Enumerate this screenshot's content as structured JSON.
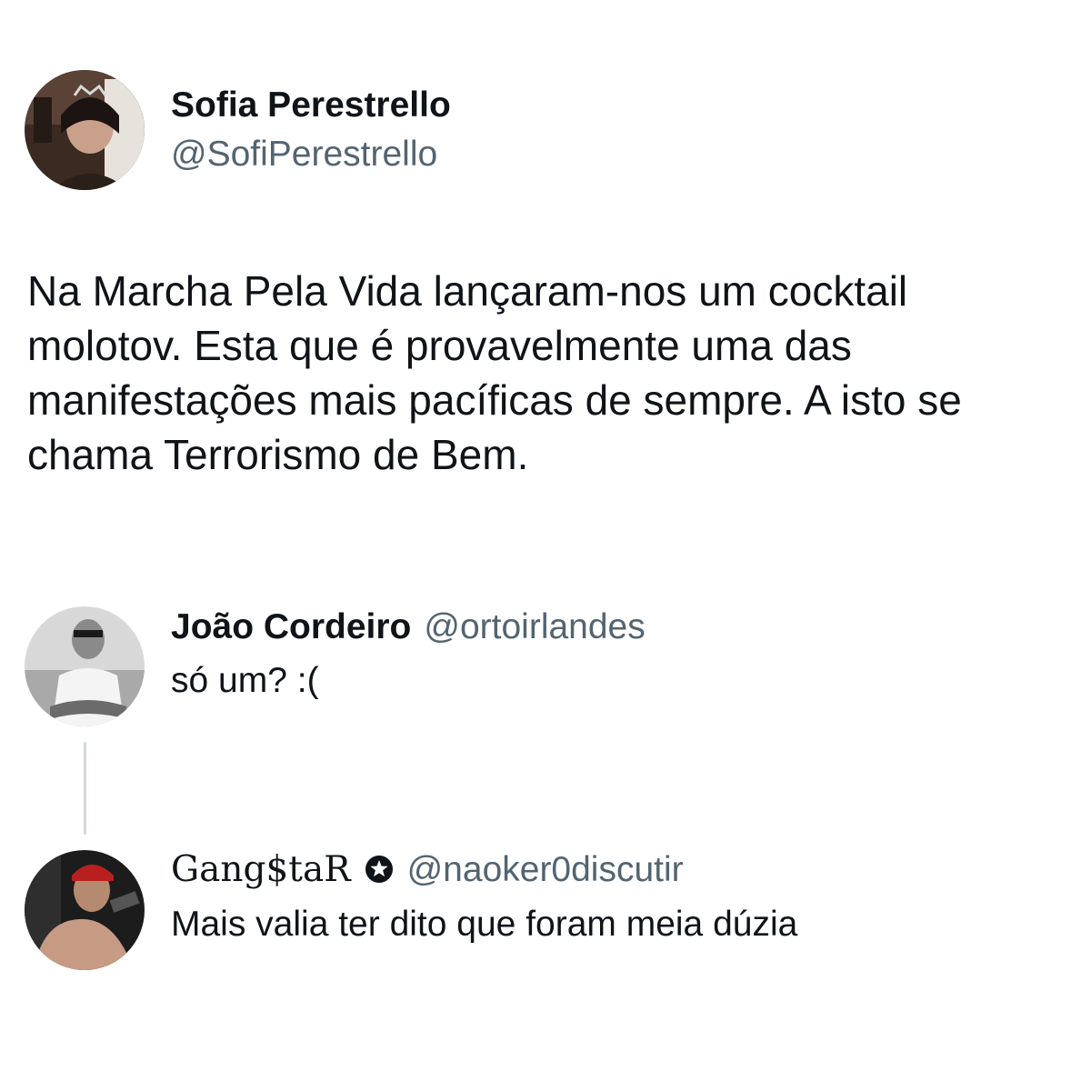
{
  "main_tweet": {
    "display_name": "Sofia Perestrello",
    "handle": "@SofiPerestrello",
    "avatar_icon": "profile-photo-avatar",
    "text": "Na Marcha Pela Vida lançaram-nos um cocktail molotov. Esta que é provavelmente uma das manifestações mais pacíficas de sempre. A isto se chama Terrorismo de Bem."
  },
  "replies": [
    {
      "display_name": "João Cordeiro",
      "handle": "@ortoirlandes",
      "avatar_icon": "profile-photo-avatar",
      "text": "só um? :("
    },
    {
      "display_name": "Gang$taR",
      "handle": "@naoker0discutir",
      "avatar_icon": "profile-photo-avatar",
      "badge_icon": "star-badge-icon",
      "text": "Mais valia ter dito que foram meia dúzia"
    }
  ],
  "colors": {
    "text_primary": "#0f1419",
    "text_secondary": "#536471",
    "thread_line": "#cfd9de",
    "background": "#ffffff"
  }
}
